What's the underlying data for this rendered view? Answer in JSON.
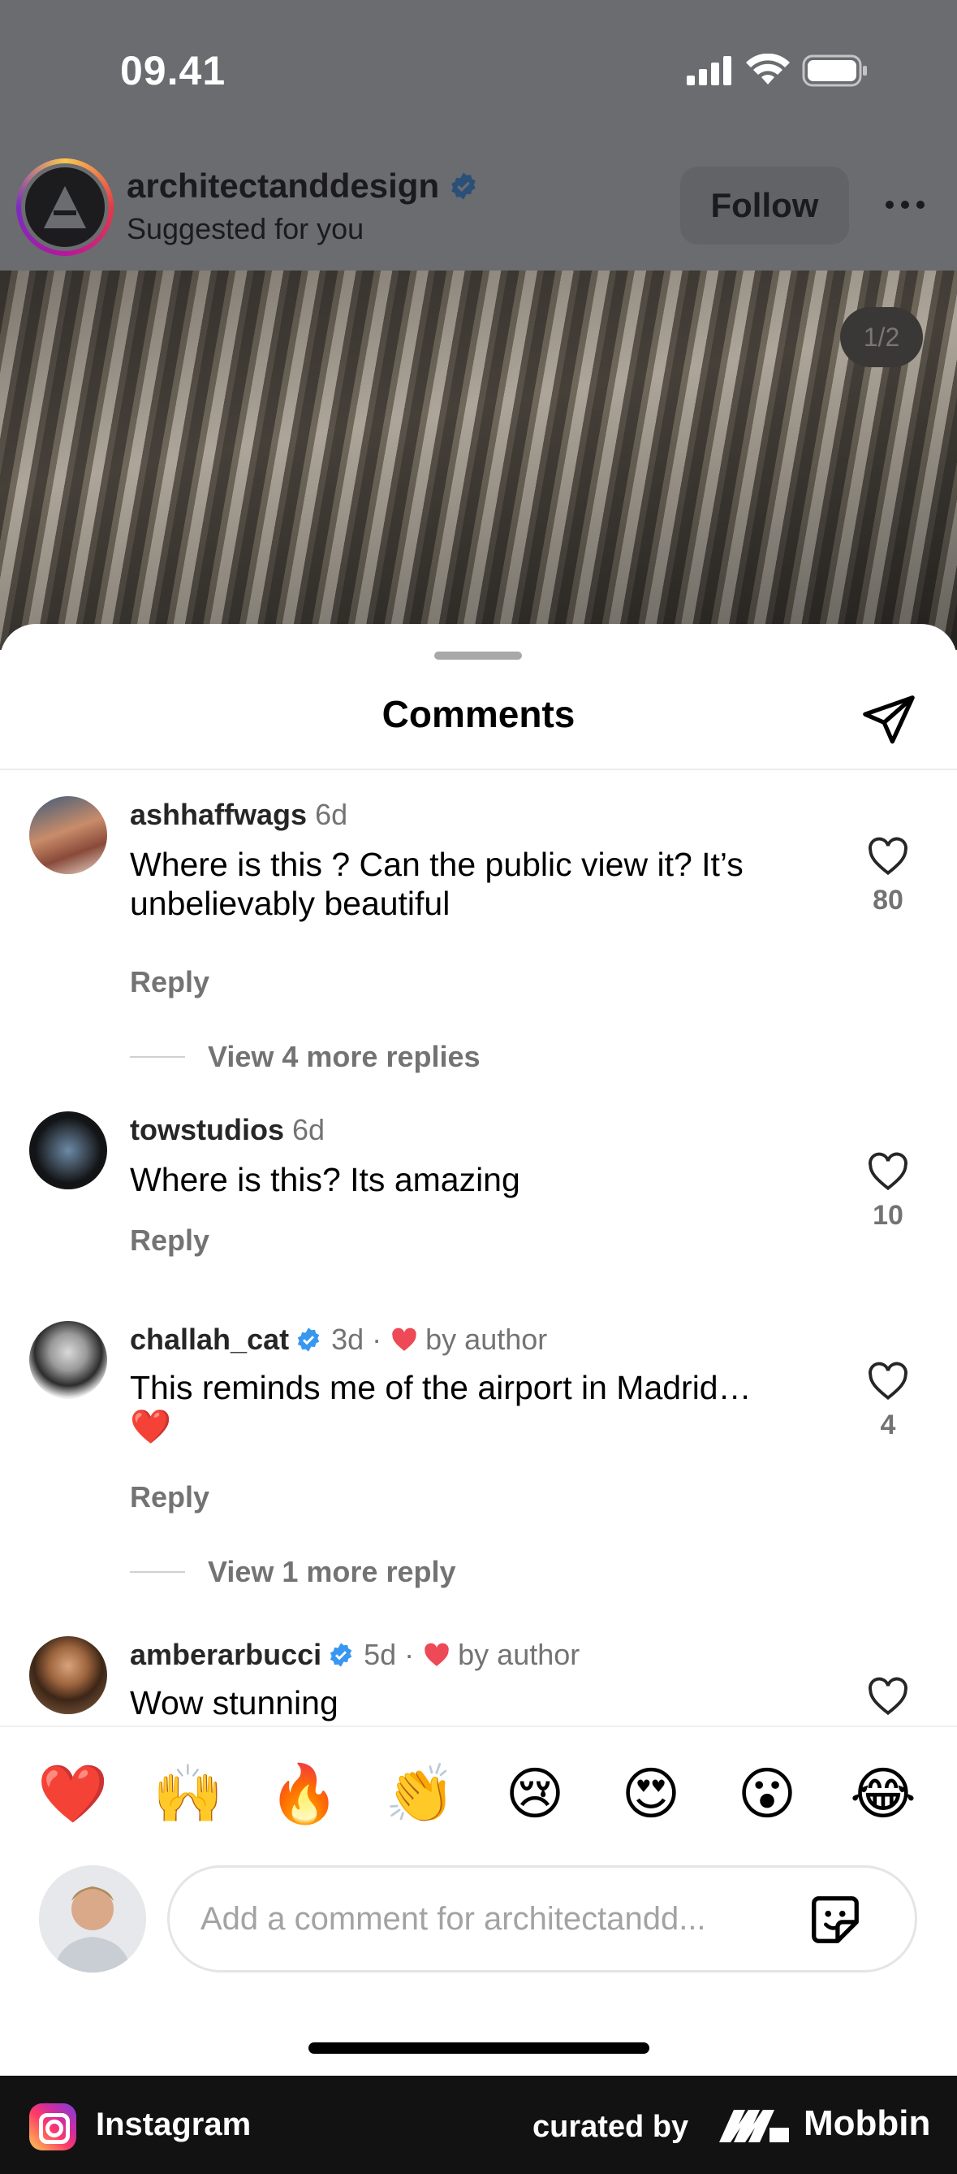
{
  "status_bar": {
    "time": "09.41"
  },
  "post": {
    "username": "architectanddesign",
    "subtitle": "Suggested for you",
    "follow_label": "Follow",
    "page_indicator": "1/2"
  },
  "sheet": {
    "title": "Comments",
    "reply_label": "Reply"
  },
  "comments": [
    {
      "username": "ashhaffwags",
      "verified": false,
      "time": "6d",
      "liked_by_author": false,
      "author_like_label": "",
      "text": "Where is this ? Can the public view it? It’s unbelievably beautiful",
      "likes": "80",
      "more_replies": "View 4 more replies"
    },
    {
      "username": "towstudios",
      "verified": false,
      "time": "6d",
      "liked_by_author": false,
      "author_like_label": "",
      "text": "Where is this? Its amazing",
      "likes": "10",
      "more_replies": ""
    },
    {
      "username": "challah_cat",
      "verified": true,
      "time": "3d",
      "liked_by_author": true,
      "author_like_label": "by author",
      "text": "This reminds me of the airport in Madrid… ❤️",
      "likes": "4",
      "more_replies": "View 1 more reply"
    },
    {
      "username": "amberarbucci",
      "verified": true,
      "time": "5d",
      "liked_by_author": true,
      "author_like_label": "by author",
      "text": "Wow stunning",
      "likes": "",
      "more_replies": ""
    }
  ],
  "reactions": [
    "❤️",
    "🙌",
    "🔥",
    "👏",
    "😢",
    "😍",
    "😮",
    "😂"
  ],
  "comment_input": {
    "placeholder": "Add a comment for architectandd..."
  },
  "footer": {
    "app_name": "Instagram",
    "curated_by": "curated by",
    "brand": "Mobbin"
  },
  "colors": {
    "verified": "#3897f0",
    "heart": "#ed4956",
    "muted": "#737373"
  }
}
